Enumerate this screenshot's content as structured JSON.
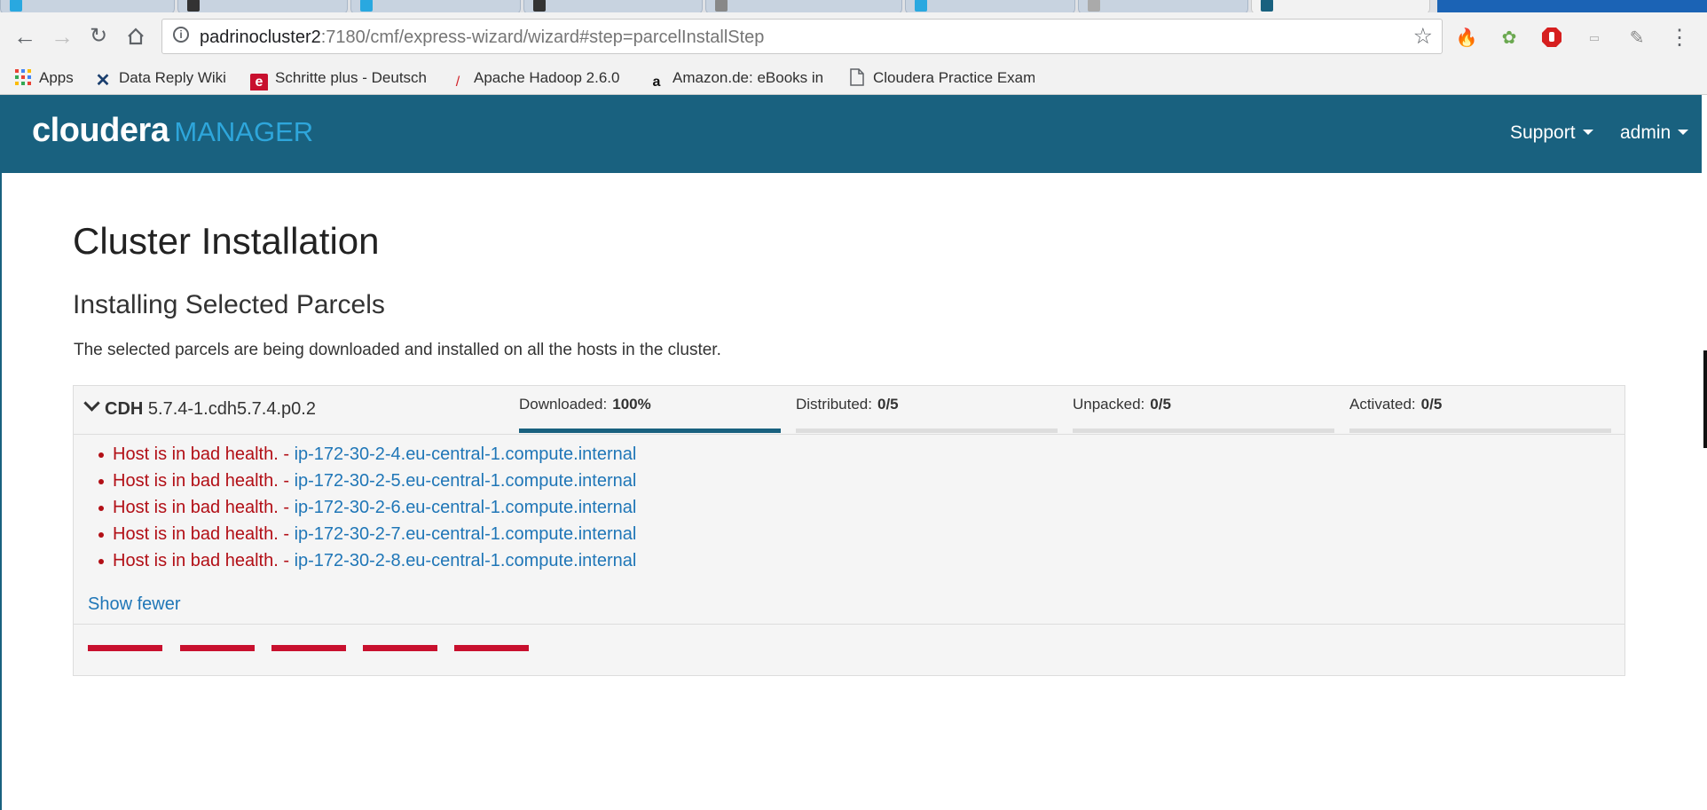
{
  "browser": {
    "url_host": "padrinocluster2",
    "url_rest": ":7180/cmf/express-wizard/wizard#step=parcelInstallStep",
    "bookmarks": [
      {
        "label": "Apps",
        "icon": "apps-grid-icon"
      },
      {
        "label": "Data Reply Wiki",
        "icon": "wiki-icon"
      },
      {
        "label": "Schritte plus - Deutsch",
        "icon": "e-logo-icon"
      },
      {
        "label": "Apache Hadoop 2.6.0",
        "icon": "feather-icon"
      },
      {
        "label": "Amazon.de: eBooks in",
        "icon": "amazon-icon"
      },
      {
        "label": "Cloudera Practice Exam",
        "icon": "page-icon"
      }
    ]
  },
  "header": {
    "brand": "cloudera",
    "product": "MANAGER",
    "support_label": "Support",
    "user_label": "admin"
  },
  "main": {
    "title": "Cluster Installation",
    "section_title": "Installing Selected Parcels",
    "description": "The selected parcels are being downloaded and installed on all the hosts in the cluster."
  },
  "parcel": {
    "name": "CDH",
    "version": "5.7.4-1.cdh5.7.4.p0.2",
    "stages": [
      {
        "label": "Downloaded:",
        "value": "100%",
        "fraction": 1.0
      },
      {
        "label": "Distributed:",
        "value": "0/5",
        "fraction": 0
      },
      {
        "label": "Unpacked:",
        "value": "0/5",
        "fraction": 0
      },
      {
        "label": "Activated:",
        "value": "0/5",
        "fraction": 0
      }
    ],
    "hosts": [
      {
        "message": "Host is in bad health. -",
        "host": "ip-172-30-2-4.eu-central-1.compute.internal"
      },
      {
        "message": "Host is in bad health. -",
        "host": "ip-172-30-2-5.eu-central-1.compute.internal"
      },
      {
        "message": "Host is in bad health. -",
        "host": "ip-172-30-2-6.eu-central-1.compute.internal"
      },
      {
        "message": "Host is in bad health. -",
        "host": "ip-172-30-2-7.eu-central-1.compute.internal"
      },
      {
        "message": "Host is in bad health. -",
        "host": "ip-172-30-2-8.eu-central-1.compute.internal"
      }
    ],
    "show_fewer_label": "Show fewer",
    "health_color": "#c8102e"
  },
  "colors": {
    "header_bg": "#19617f",
    "accent": "#2ea6db",
    "link": "#1f76b7",
    "error": "#b20f16"
  }
}
